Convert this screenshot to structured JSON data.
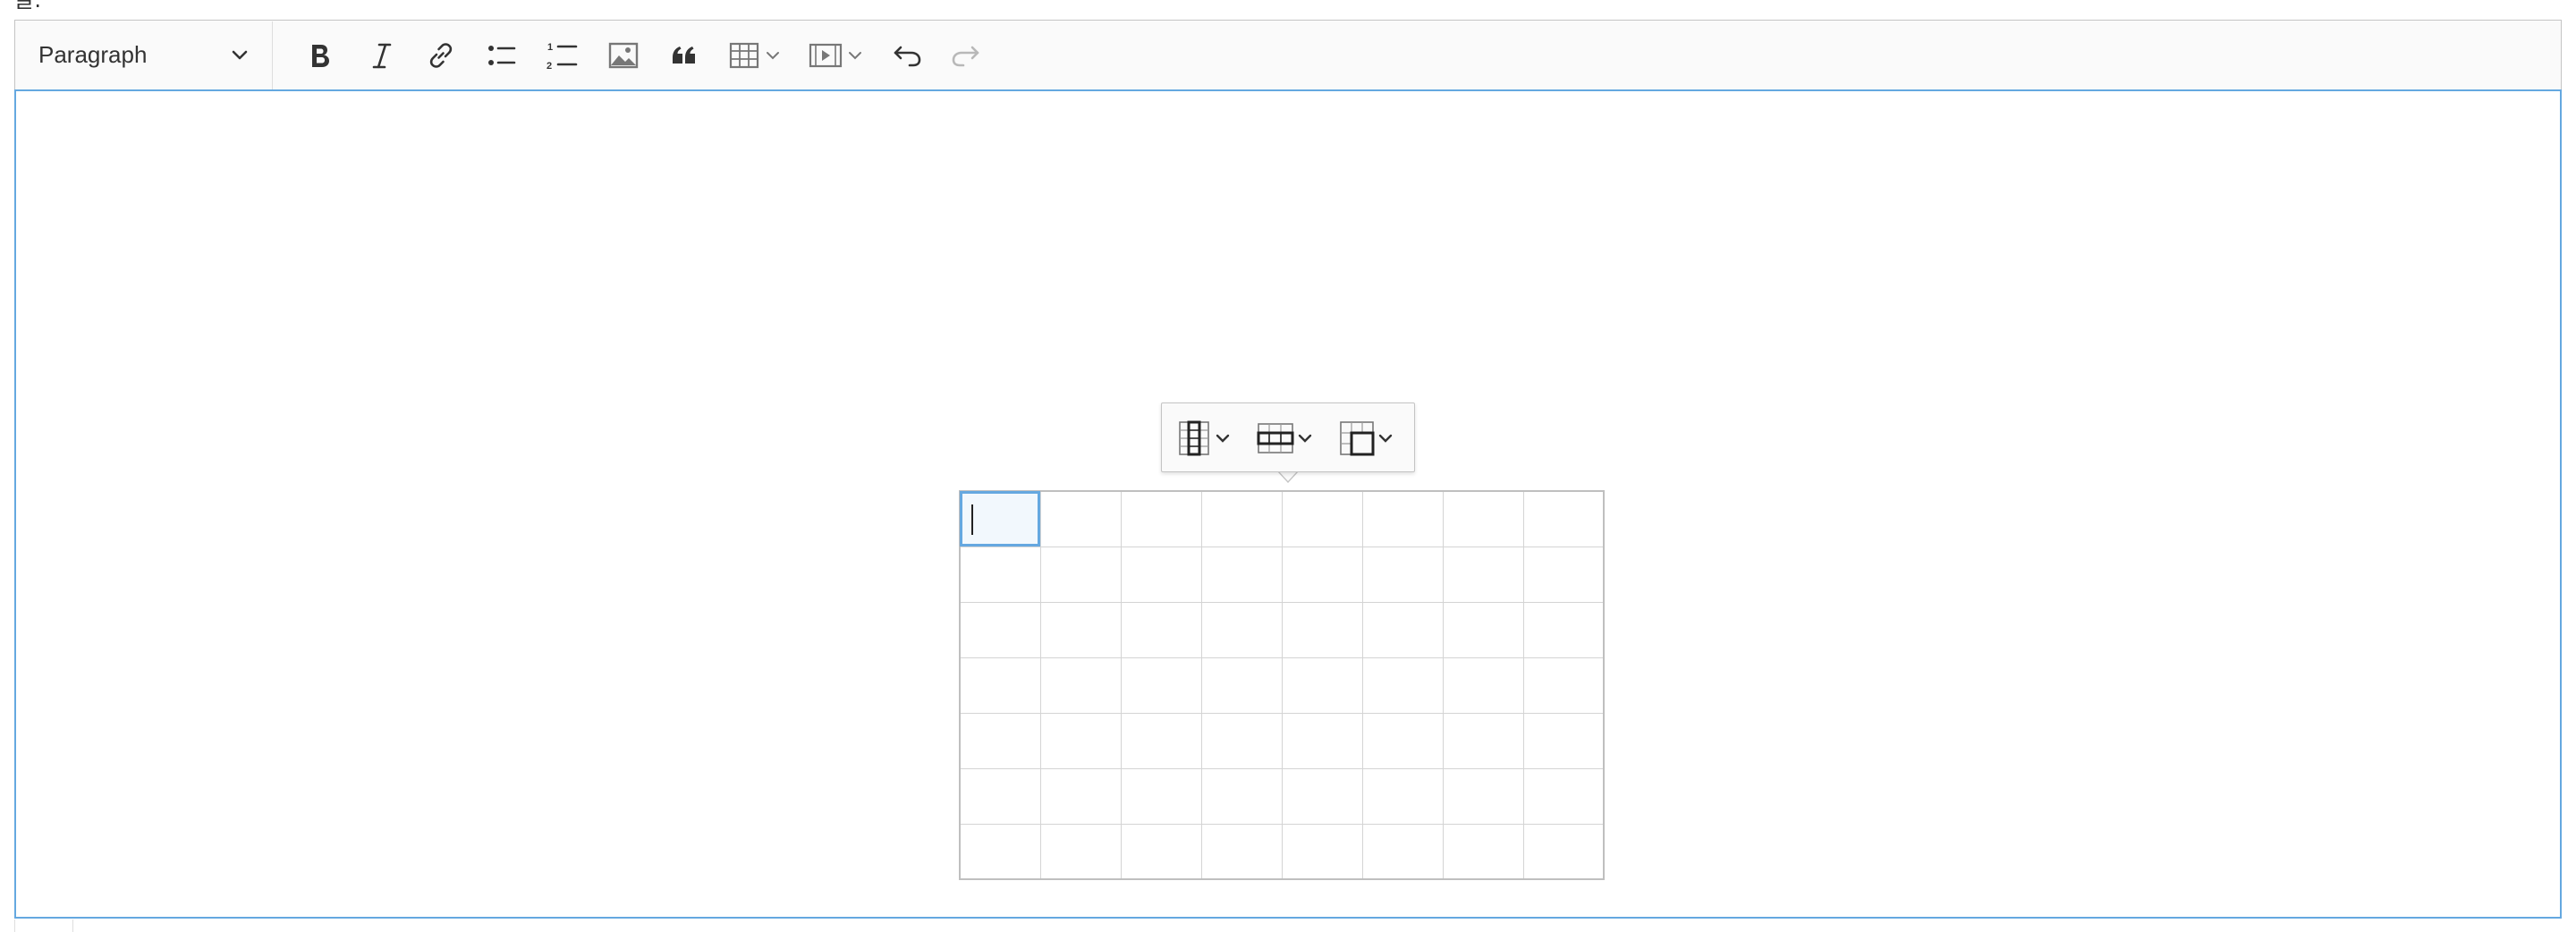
{
  "page": {
    "top_label": "글:"
  },
  "toolbar": {
    "heading": {
      "selected_label": "Paragraph",
      "icon": "chevron-down-icon"
    },
    "buttons": [
      {
        "name": "bold",
        "icon": "bold-icon",
        "enabled": true
      },
      {
        "name": "italic",
        "icon": "italic-icon",
        "enabled": true
      },
      {
        "name": "link",
        "icon": "link-icon",
        "enabled": true
      },
      {
        "name": "bulleted-list",
        "icon": "bulleted-list-icon",
        "enabled": true
      },
      {
        "name": "numbered-list",
        "icon": "numbered-list-icon",
        "enabled": true
      },
      {
        "name": "insert-image",
        "icon": "image-icon",
        "enabled": true
      },
      {
        "name": "block-quote",
        "icon": "quote-icon",
        "enabled": true
      },
      {
        "name": "insert-table",
        "icon": "table-icon",
        "enabled": true,
        "has_dropdown": true
      },
      {
        "name": "insert-media",
        "icon": "media-icon",
        "enabled": true,
        "has_dropdown": true
      },
      {
        "name": "undo",
        "icon": "undo-icon",
        "enabled": true
      },
      {
        "name": "redo",
        "icon": "redo-icon",
        "enabled": false
      }
    ]
  },
  "table_toolbar": {
    "buttons": [
      {
        "name": "table-column",
        "icon": "table-column-icon",
        "has_dropdown": true
      },
      {
        "name": "table-row",
        "icon": "table-row-icon",
        "has_dropdown": true
      },
      {
        "name": "merge-cells",
        "icon": "merge-cells-icon",
        "has_dropdown": true
      }
    ]
  },
  "table": {
    "rows": 7,
    "columns": 8,
    "selected_cell": {
      "row": 1,
      "column": 1
    },
    "cells": []
  },
  "colors": {
    "focus_border": "#65a8e0",
    "toolbar_bg": "#fafafa",
    "border": "#c4c4c4",
    "icon": "#333333",
    "icon_disabled": "#b8b8b8"
  }
}
